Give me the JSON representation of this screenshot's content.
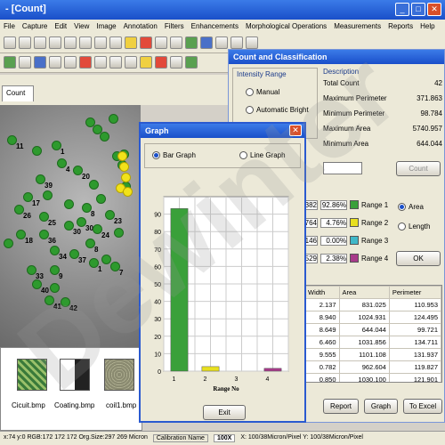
{
  "window": {
    "title": "- [Count]"
  },
  "menu": [
    "File",
    "Capture",
    "Edit",
    "View",
    "Image",
    "Annotation",
    "Filters",
    "Enhancements",
    "Morphological Operations",
    "Measurements",
    "Reports",
    "Help"
  ],
  "tab": "Count",
  "thumbnails": [
    "Cicuit.bmp",
    "Coating.bmp",
    "coil1.bmp"
  ],
  "status": {
    "coords": "x:74 y:0 RGB:172 172 172 Org.Size:297 269 Micron",
    "calib_label": "Calibration Name",
    "calib_value": "100X",
    "pixel": "X: 100/38Micron/Pixel Y: 100/38Micron/Pixel"
  },
  "classify": {
    "title": "Count and Classification",
    "intensity_label": "Intensity Range",
    "manual": "Manual",
    "auto": "Automatic Bright",
    "description_label": "Description",
    "stats": [
      {
        "label": "Total Count",
        "value": "42"
      },
      {
        "label": "Maximum Perimeter",
        "value": "371.863"
      },
      {
        "label": "Minimum Perimeter",
        "value": "98.784"
      },
      {
        "label": "Maximum Area",
        "value": "5740.957"
      },
      {
        "label": "Minimum Area",
        "value": "644.044"
      }
    ],
    "count_btn": "Count",
    "ranges": [
      {
        "a": "382",
        "b": "92.86%",
        "label": "Range 1",
        "color": "#3aa03a"
      },
      {
        "a": "764",
        "b": "4.76%",
        "label": "Range 2",
        "color": "#e8e020"
      },
      {
        "a": "146",
        "b": "0.00%",
        "label": "Range 3",
        "color": "#40b8c8"
      },
      {
        "a": "529",
        "b": "2.38%",
        "label": "Range 4",
        "color": "#a83a8a"
      }
    ],
    "area": "Area",
    "length": "Length",
    "ok": "OK",
    "table_headers": [
      "Width",
      "Area",
      "Perimeter"
    ],
    "rows": [
      [
        "2.137",
        "831.025",
        "110.953"
      ],
      [
        "8.940",
        "1024.931",
        "124.495"
      ],
      [
        "8.649",
        "644.044",
        "99.721"
      ],
      [
        "6.460",
        "1031.856",
        "134.711"
      ],
      [
        "9.555",
        "1101.108",
        "131.937"
      ],
      [
        "0.782",
        "962.604",
        "119.827"
      ],
      [
        "0.850",
        "1030.100",
        "121.901"
      ]
    ],
    "report": "Report",
    "graph": "Graph",
    "to_excel": "To Excel"
  },
  "graph": {
    "title": "Graph",
    "bar": "Bar Graph",
    "line": "Line Graph",
    "exit": "Exit"
  },
  "chart_data": {
    "type": "bar",
    "categories": [
      "1",
      "2",
      "3",
      "4"
    ],
    "values": [
      93.2,
      2.6,
      0,
      1.6
    ],
    "colors": [
      "#3aa03a",
      "#e8e020",
      "#40b8c8",
      "#a83a8a"
    ],
    "xlabel": "Range No",
    "ylabel": "",
    "yticks": [
      "90",
      "80",
      "70",
      "60",
      "50",
      "40",
      "30",
      "20",
      "10",
      "0"
    ],
    "ylim": [
      0,
      100
    ]
  },
  "watermark": "Dewinter"
}
